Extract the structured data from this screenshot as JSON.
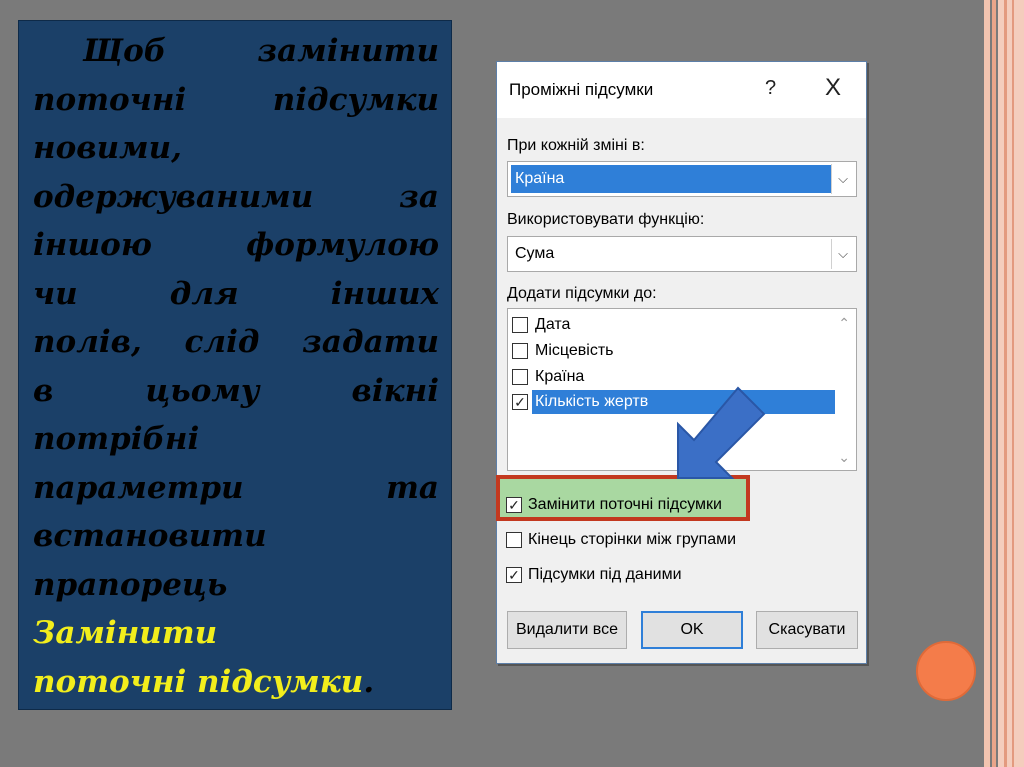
{
  "slide": {
    "paragraph_lines": [
      "Щоб замінити",
      "поточні підсумки",
      "новими,",
      "одержуваними за",
      "іншою формулою",
      "чи для інших",
      "полів, слід задати",
      "в цьому вікні",
      "потрібні",
      "параметри та",
      "встановити",
      "прапорець"
    ],
    "highlight_lines": [
      "Замінити",
      "поточні підсумки"
    ],
    "trailing_period": ".",
    "highlight_color": "#f2ee1c",
    "panel_color": "#1b4068"
  },
  "dialog": {
    "title": "Проміжні підсумки",
    "help_glyph": "?",
    "close_glyph": "X",
    "group_label": "При кожній зміні в:",
    "group_value": "Країна",
    "function_label": "Використовувати функцію:",
    "function_value": "Сума",
    "add_label": "Додати підсумки до:",
    "fields": [
      {
        "label": "Дата",
        "checked": false
      },
      {
        "label": "Місцевість",
        "checked": false
      },
      {
        "label": "Країна",
        "checked": false
      },
      {
        "label": "Кількість жертв",
        "checked": true
      }
    ],
    "options": [
      {
        "label": "Замінити поточні підсумки",
        "checked": true
      },
      {
        "label": "Кінець сторінки між групами",
        "checked": false
      },
      {
        "label": "Підсумки під даними",
        "checked": true
      }
    ],
    "buttons": {
      "remove_all": "Видалити все",
      "ok": "OK",
      "cancel": "Скасувати"
    },
    "selection_color": "#2f7fd8",
    "highlight_border_color": "#c3391f",
    "highlight_fill_color": "#a9d8a1",
    "arrow_color": "#3b6fc6"
  }
}
